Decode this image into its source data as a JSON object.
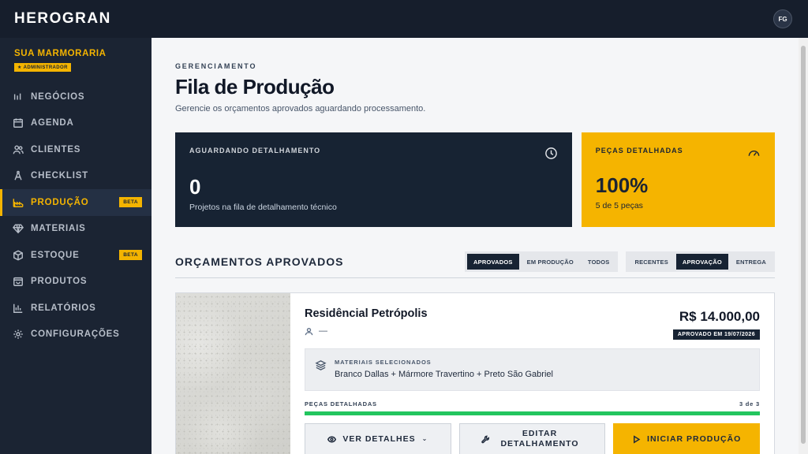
{
  "app": {
    "brand": "HEROGRAN",
    "user_initials": "FG"
  },
  "sidebar": {
    "org_name": "SUA MARMORARIA",
    "role_badge": "★ ADMINISTRADOR",
    "items": [
      {
        "label": "NEGÓCIOS",
        "icon": "bars-icon"
      },
      {
        "label": "AGENDA",
        "icon": "calendar-icon"
      },
      {
        "label": "CLIENTES",
        "icon": "users-icon"
      },
      {
        "label": "CHECKLIST",
        "icon": "compass-icon"
      },
      {
        "label": "PRODUÇÃO",
        "icon": "factory-icon",
        "badge": "BETA",
        "active": true
      },
      {
        "label": "MATERIAIS",
        "icon": "gem-icon"
      },
      {
        "label": "ESTOQUE",
        "icon": "box-icon",
        "badge": "BETA"
      },
      {
        "label": "PRODUTOS",
        "icon": "bag-icon"
      },
      {
        "label": "RELATÓRIOS",
        "icon": "chart-icon"
      },
      {
        "label": "CONFIGURAÇÕES",
        "icon": "gear-icon"
      }
    ]
  },
  "header": {
    "eyebrow": "GERENCIAMENTO",
    "title": "Fila de Produção",
    "subtitle": "Gerencie os orçamentos aprovados aguardando processamento."
  },
  "stats": {
    "waiting": {
      "label": "AGUARDANDO DETALHAMENTO",
      "value": "0",
      "desc": "Projetos na fila de detalhamento técnico"
    },
    "detailed": {
      "label": "PEÇAS DETALHADAS",
      "value": "100%",
      "desc": "5 de 5 peças"
    }
  },
  "section": {
    "title": "ORÇAMENTOS APROVADOS",
    "status_filters": [
      "APROVADOS",
      "EM PRODUÇÃO",
      "TODOS"
    ],
    "sort_filters": [
      "RECENTES",
      "APROVAÇÃO",
      "ENTREGA"
    ]
  },
  "project": {
    "name": "Residêncial Petrópolis",
    "client": "—",
    "price": "R$ 14.000,00",
    "approved_badge": "APROVADO EM 19/07/2026",
    "materials_label": "MATERIAIS SELECIONADOS",
    "materials_value": "Branco Dallas + Mármore Travertino + Preto São Gabriel",
    "progress_label": "PEÇAS DETALHADAS",
    "progress_count": "3 de 3",
    "progress_fraction": 1.0,
    "actions": {
      "details": "VER DETALHES",
      "edit": "EDITAR DETALHAMENTO",
      "start": "INICIAR PRODUÇÃO"
    }
  }
}
